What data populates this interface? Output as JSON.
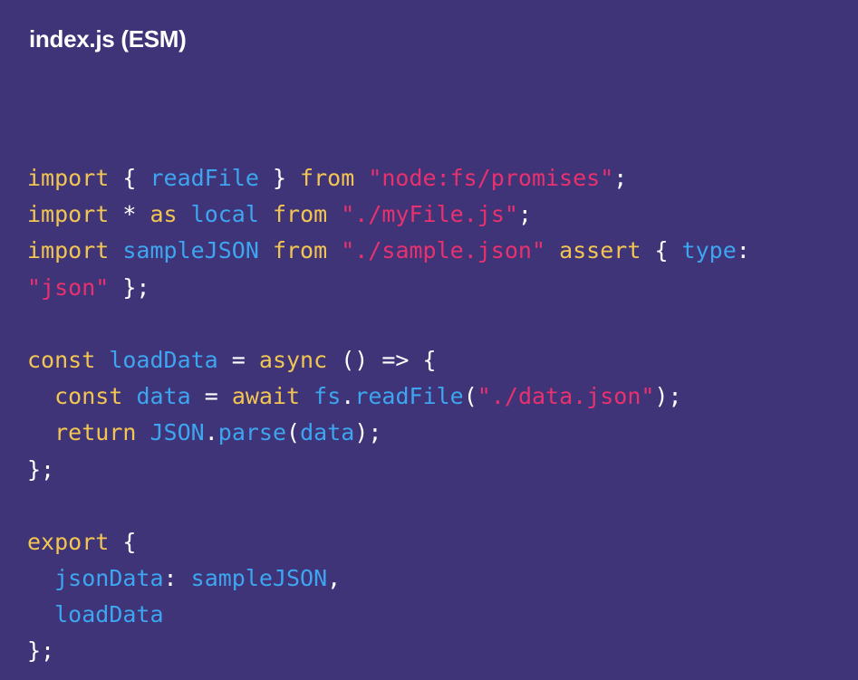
{
  "title": "index.js (ESM)",
  "colors": {
    "background": "#3e3477",
    "keyword": "#f3c553",
    "identifier": "#3ea5f0",
    "string": "#e9316f",
    "punctuation": "#ffffff"
  },
  "code": {
    "lines": [
      [
        {
          "t": "import",
          "c": "kw"
        },
        {
          "t": " { ",
          "c": "pn"
        },
        {
          "t": "readFile",
          "c": "id"
        },
        {
          "t": " } ",
          "c": "pn"
        },
        {
          "t": "from",
          "c": "kw"
        },
        {
          "t": " ",
          "c": "pn"
        },
        {
          "t": "\"node:fs/promises\"",
          "c": "str"
        },
        {
          "t": ";",
          "c": "pn"
        }
      ],
      [
        {
          "t": "import",
          "c": "kw"
        },
        {
          "t": " * ",
          "c": "pn"
        },
        {
          "t": "as",
          "c": "kw"
        },
        {
          "t": " ",
          "c": "pn"
        },
        {
          "t": "local",
          "c": "id"
        },
        {
          "t": " ",
          "c": "pn"
        },
        {
          "t": "from",
          "c": "kw"
        },
        {
          "t": " ",
          "c": "pn"
        },
        {
          "t": "\"./myFile.js\"",
          "c": "str"
        },
        {
          "t": ";",
          "c": "pn"
        }
      ],
      [
        {
          "t": "import",
          "c": "kw"
        },
        {
          "t": " ",
          "c": "pn"
        },
        {
          "t": "sampleJSON",
          "c": "id"
        },
        {
          "t": " ",
          "c": "pn"
        },
        {
          "t": "from",
          "c": "kw"
        },
        {
          "t": " ",
          "c": "pn"
        },
        {
          "t": "\"./sample.json\"",
          "c": "str"
        },
        {
          "t": " ",
          "c": "pn"
        },
        {
          "t": "assert",
          "c": "kw"
        },
        {
          "t": " { ",
          "c": "pn"
        },
        {
          "t": "type",
          "c": "id"
        },
        {
          "t": ":",
          "c": "pn"
        }
      ],
      [
        {
          "t": "\"json\"",
          "c": "str"
        },
        {
          "t": " };",
          "c": "pn"
        }
      ],
      [],
      [
        {
          "t": "const",
          "c": "kw"
        },
        {
          "t": " ",
          "c": "pn"
        },
        {
          "t": "loadData",
          "c": "id"
        },
        {
          "t": " = ",
          "c": "pn"
        },
        {
          "t": "async",
          "c": "kw"
        },
        {
          "t": " () => {",
          "c": "pn"
        }
      ],
      [
        {
          "t": "  ",
          "c": "pn"
        },
        {
          "t": "const",
          "c": "kw"
        },
        {
          "t": " ",
          "c": "pn"
        },
        {
          "t": "data",
          "c": "id"
        },
        {
          "t": " = ",
          "c": "pn"
        },
        {
          "t": "await",
          "c": "kw"
        },
        {
          "t": " ",
          "c": "pn"
        },
        {
          "t": "fs",
          "c": "id"
        },
        {
          "t": ".",
          "c": "pn"
        },
        {
          "t": "readFile",
          "c": "id"
        },
        {
          "t": "(",
          "c": "pn"
        },
        {
          "t": "\"./data.json\"",
          "c": "str"
        },
        {
          "t": ");",
          "c": "pn"
        }
      ],
      [
        {
          "t": "  ",
          "c": "pn"
        },
        {
          "t": "return",
          "c": "kw"
        },
        {
          "t": " ",
          "c": "pn"
        },
        {
          "t": "JSON",
          "c": "id"
        },
        {
          "t": ".",
          "c": "pn"
        },
        {
          "t": "parse",
          "c": "id"
        },
        {
          "t": "(",
          "c": "pn"
        },
        {
          "t": "data",
          "c": "id"
        },
        {
          "t": ");",
          "c": "pn"
        }
      ],
      [
        {
          "t": "};",
          "c": "pn"
        }
      ],
      [],
      [
        {
          "t": "export",
          "c": "kw"
        },
        {
          "t": " {",
          "c": "pn"
        }
      ],
      [
        {
          "t": "  ",
          "c": "pn"
        },
        {
          "t": "jsonData",
          "c": "id"
        },
        {
          "t": ": ",
          "c": "pn"
        },
        {
          "t": "sampleJSON",
          "c": "id"
        },
        {
          "t": ",",
          "c": "pn"
        }
      ],
      [
        {
          "t": "  ",
          "c": "pn"
        },
        {
          "t": "loadData",
          "c": "id"
        }
      ],
      [
        {
          "t": "};",
          "c": "pn"
        }
      ]
    ]
  }
}
